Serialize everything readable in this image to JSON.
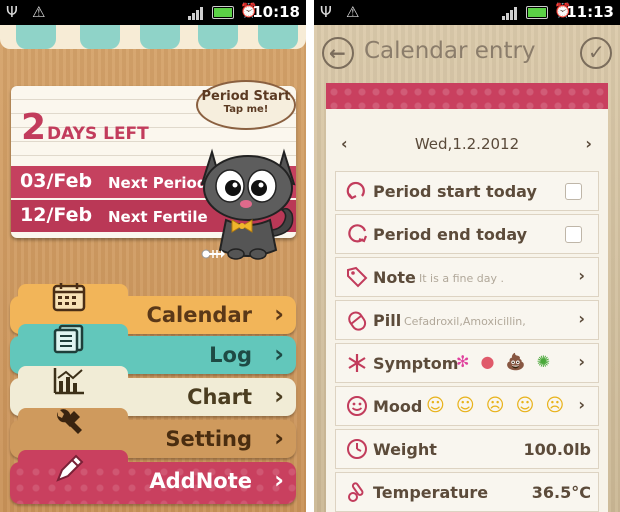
{
  "left_screen": {
    "status": {
      "time": "10:18"
    },
    "days_left": {
      "number": "2",
      "text": "DAYS LEFT"
    },
    "bubble": {
      "title": "Period Start",
      "subtitle": "Tap me!"
    },
    "next_period": {
      "date": "03/Feb",
      "label": "Next Period"
    },
    "next_fertile": {
      "date": "12/Feb",
      "label": "Next Fertile"
    },
    "menu": [
      {
        "label": "Calendar",
        "icon": "calendar-icon"
      },
      {
        "label": "Log",
        "icon": "log-icon"
      },
      {
        "label": "Chart",
        "icon": "chart-icon"
      },
      {
        "label": "Setting",
        "icon": "wrench-icon"
      },
      {
        "label": "AddNote",
        "icon": "pencil-icon"
      }
    ],
    "chevron": "›"
  },
  "right_screen": {
    "status": {
      "time": "11:13"
    },
    "header": {
      "title": "Calendar entry"
    },
    "date": {
      "value": "Wed,1.2.2012",
      "prev": "‹",
      "next": "›"
    },
    "entries": [
      {
        "label": "Period start today",
        "type": "checkbox",
        "checked": false
      },
      {
        "label": "Period end today",
        "type": "checkbox",
        "checked": false
      },
      {
        "label": "Note",
        "note": "It is a fine day .",
        "type": "chevron"
      },
      {
        "label": "Pill",
        "note": "Cefadroxil,Amoxicillin,",
        "type": "chevron"
      },
      {
        "label": "Symptom",
        "type": "chevron",
        "emojis": [
          "✻",
          "●",
          "💩",
          "✺"
        ]
      },
      {
        "label": "Mood",
        "type": "chevron",
        "emojis": [
          "☺",
          "☺",
          "☹",
          "☺",
          "☹"
        ]
      },
      {
        "label": "Weight",
        "value": "100.0lb",
        "type": "value"
      },
      {
        "label": "Temperature",
        "value": "36.5°C",
        "type": "value"
      }
    ],
    "chevron": "›"
  },
  "colors": {
    "pink": "#c5415f",
    "teal": "#62c7bb",
    "orange": "#f2b559",
    "cream": "#f1ecd6",
    "wood": "#cf9a5d"
  }
}
